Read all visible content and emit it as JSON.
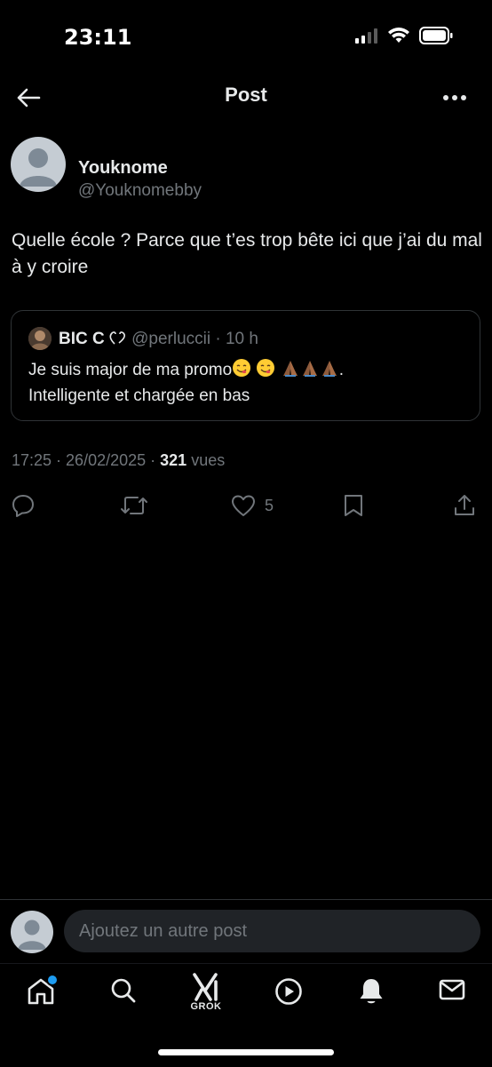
{
  "status_bar": {
    "time": "23:11"
  },
  "header": {
    "title": "Post"
  },
  "post": {
    "author_name": "Youknome",
    "author_handle": "@Youknomebby",
    "text": "Quelle école ? Parce que t’es trop bête ici que j’ai du mal à y croire",
    "quote": {
      "name": "BIC C ",
      "handle": "@perluccii",
      "time": "· 10 h",
      "line1": "Je suis major de ma promo",
      "line1_end": ".",
      "line2": "Intelligente et chargée en bas"
    },
    "meta": {
      "time": "17:25",
      "date": "26/02/2025",
      "views_count": "321",
      "views_label": "vues"
    },
    "actions": {
      "like_count": "5"
    }
  },
  "reply_bar": {
    "placeholder": "Ajoutez un autre post"
  },
  "tabbar": {
    "items": [
      "home",
      "search",
      "grok",
      "video",
      "notifications",
      "messages"
    ],
    "grok_label": "GROK"
  },
  "colors": {
    "accent": "#1d9bf0",
    "muted": "#71767b",
    "text": "#e7e9ea",
    "border": "#2f3336"
  }
}
